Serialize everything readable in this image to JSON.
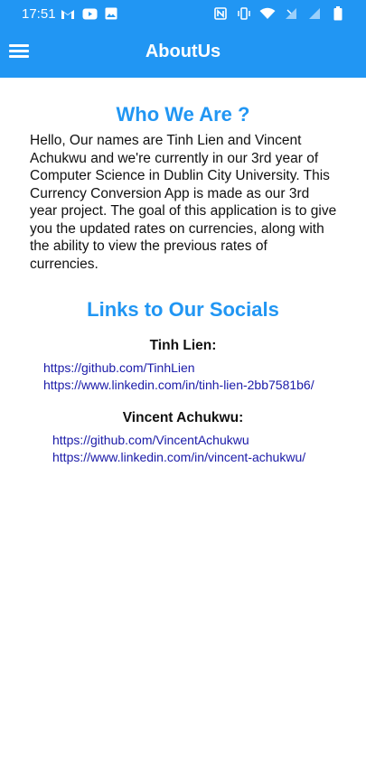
{
  "status_bar": {
    "time": "17:51",
    "left_icons": [
      "gmail-icon",
      "youtube-icon",
      "gallery-icon"
    ],
    "right_icons": [
      "nfc-icon",
      "vibrate-icon",
      "wifi-icon",
      "signal-icon",
      "signal-icon",
      "battery-icon"
    ]
  },
  "app_bar": {
    "title": "AboutUs",
    "menu_icon": "menu-icon",
    "background": "#2196F3"
  },
  "about": {
    "heading": "Who We Are ?",
    "paragraph": "Hello, Our names are Tinh Lien and Vincent Achukwu and we're currently in our 3rd year of Computer Science in Dublin City University. This Currency Conversion App is made as our 3rd year project. The goal of this application is to give you the updated rates on currencies, along with the ability to view the previous rates of currencies."
  },
  "socials": {
    "heading": "Links to Our Socials",
    "people": [
      {
        "name": "Tinh Lien:",
        "links": [
          "https://github.com/TinhLien",
          "https://www.linkedin.com/in/tinh-lien-2bb7581b6/"
        ]
      },
      {
        "name": "Vincent Achukwu:",
        "links": [
          "https://github.com/VincentAchukwu",
          "https://www.linkedin.com/in/vincent-achukwu/"
        ]
      }
    ]
  },
  "colors": {
    "accent": "#2196F3",
    "link": "#1a1aa8"
  }
}
